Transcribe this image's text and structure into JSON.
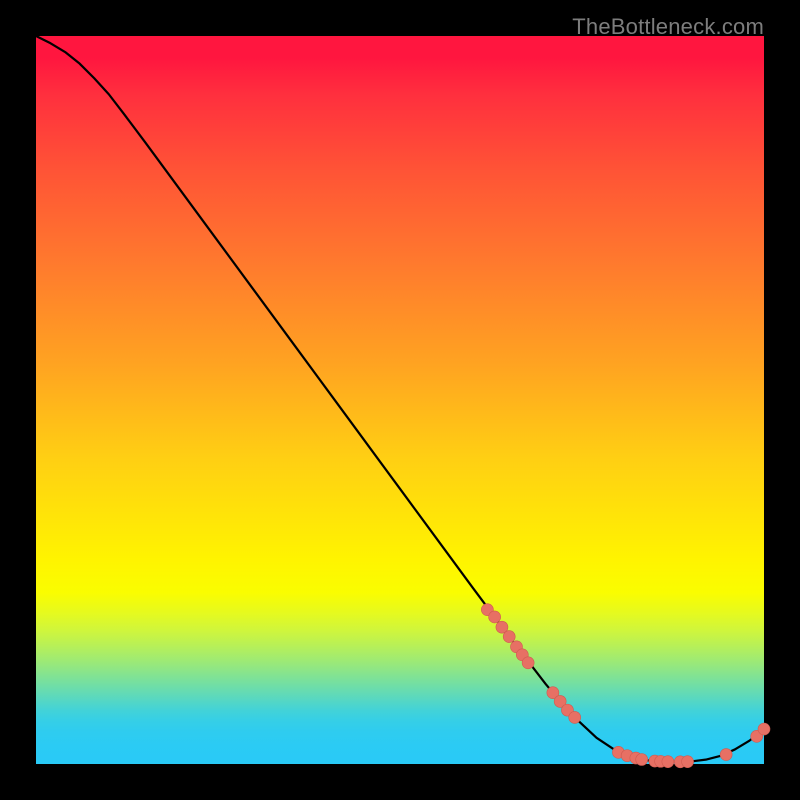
{
  "watermark": "TheBottleneck.com",
  "colors": {
    "background": "#000000",
    "line": "#000000",
    "marker_fill": "#e77064",
    "marker_stroke": "#d05a4f",
    "watermark": "#7d7d7d"
  },
  "chart_data": {
    "type": "line",
    "title": "",
    "xlabel": "",
    "ylabel": "",
    "xlim": [
      0,
      100
    ],
    "ylim": [
      0,
      100
    ],
    "grid": false,
    "series": [
      {
        "name": "bottleneck-curve",
        "x": [
          0,
          2,
          4,
          6,
          8,
          10,
          12,
          15,
          20,
          25,
          30,
          35,
          40,
          45,
          50,
          55,
          60,
          65,
          70,
          72,
          74,
          77,
          80,
          82,
          84,
          86,
          88,
          90,
          92,
          94,
          96,
          98,
          100
        ],
        "y": [
          100,
          99.0,
          97.8,
          96.2,
          94.2,
          92.0,
          89.4,
          85.4,
          78.6,
          71.8,
          65.0,
          58.2,
          51.4,
          44.6,
          37.8,
          31.0,
          24.2,
          17.5,
          11.0,
          8.6,
          6.4,
          3.6,
          1.6,
          0.9,
          0.5,
          0.35,
          0.3,
          0.35,
          0.6,
          1.1,
          2.0,
          3.2,
          4.8
        ]
      }
    ],
    "markers": {
      "name": "highlighted-points",
      "x": [
        62,
        63,
        64,
        65,
        66,
        66.8,
        67.6,
        71,
        72,
        73,
        74,
        80,
        81.2,
        82.4,
        83.2,
        85,
        85.8,
        86.8,
        88.5,
        89.5,
        94.8,
        99,
        100
      ],
      "y": [
        21.2,
        20.2,
        18.8,
        17.5,
        16.1,
        15.0,
        13.9,
        9.8,
        8.6,
        7.4,
        6.4,
        1.6,
        1.15,
        0.82,
        0.62,
        0.4,
        0.36,
        0.32,
        0.3,
        0.32,
        1.3,
        3.8,
        4.8
      ]
    }
  }
}
